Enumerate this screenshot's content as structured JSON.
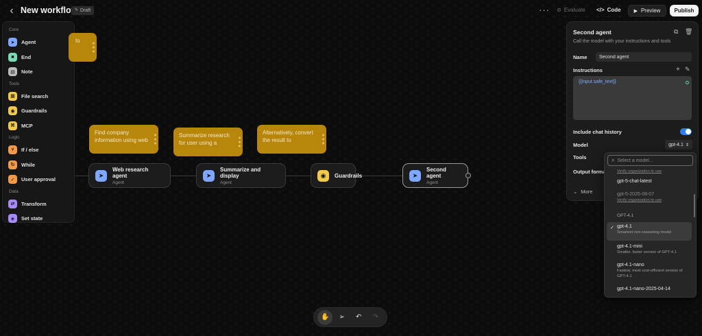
{
  "header": {
    "back_icon": "chevron-left-icon",
    "title": "New workflow",
    "draft_label": "Draft",
    "more_label": "···",
    "evaluate_label": "Evaluate",
    "code_label": "Code",
    "preview_label": "Preview",
    "publish_label": "Publish"
  },
  "palette": {
    "sections": [
      {
        "label": "Core",
        "items": [
          {
            "label": "Agent",
            "icon": "agent-icon",
            "color": "#7ea8ff"
          },
          {
            "label": "End",
            "icon": "end-icon",
            "color": "#79d9b4"
          },
          {
            "label": "Note",
            "icon": "note-icon",
            "color": "#bdbdbd"
          }
        ]
      },
      {
        "label": "Tools",
        "items": [
          {
            "label": "File search",
            "icon": "file-search-icon",
            "color": "#f2c94c"
          },
          {
            "label": "Guardrails",
            "icon": "guardrails-icon",
            "color": "#f2c94c"
          },
          {
            "label": "MCP",
            "icon": "mcp-icon",
            "color": "#f2c94c"
          }
        ]
      },
      {
        "label": "Logic",
        "items": [
          {
            "label": "If / else",
            "icon": "if-else-icon",
            "color": "#f2994a"
          },
          {
            "label": "While",
            "icon": "while-icon",
            "color": "#f2994a"
          },
          {
            "label": "User approval",
            "icon": "user-approval-icon",
            "color": "#f2994a"
          }
        ]
      },
      {
        "label": "Data",
        "items": [
          {
            "label": "Transform",
            "icon": "transform-icon",
            "color": "#a78bfa"
          },
          {
            "label": "Set state",
            "icon": "set-state-icon",
            "color": "#a78bfa"
          }
        ]
      }
    ]
  },
  "canvas": {
    "notes": [
      {
        "text": "to"
      },
      {
        "text": "Find company information using web"
      },
      {
        "text": "Summarize research for user using a"
      },
      {
        "text": "Alternatively, convert the result to"
      }
    ],
    "nodes": [
      {
        "title": "Web research agent",
        "subtitle": "Agent"
      },
      {
        "title": "Summarize and display",
        "subtitle": "Agent"
      },
      {
        "title": "Guardrails",
        "subtitle": ""
      },
      {
        "title": "Second agent",
        "subtitle": "Agent"
      }
    ]
  },
  "panel": {
    "title": "Second agent",
    "description": "Call the model with your instructions and tools",
    "name_label": "Name",
    "name_value": "Second agent",
    "instructions_label": "Instructions",
    "instructions_value": "{{input.safe_text}}",
    "chat_history_label": "Include chat history",
    "chat_history_on": true,
    "model_label": "Model",
    "model_value": "gpt-4.1",
    "tools_label": "Tools",
    "output_format_label": "Output forma",
    "more_label": "More"
  },
  "model_dropdown": {
    "search_placeholder": "Select a model...",
    "top_partial_link": "Verify organization to use",
    "options_a": [
      {
        "title": "gpt-5-chat-latest",
        "subtitle": ""
      },
      {
        "title": "gpt-5-2025-08-07",
        "subtitle": "Verify organization to use"
      }
    ],
    "group_label": "GPT-4.1",
    "options_b": [
      {
        "title": "gpt-4.1",
        "subtitle": "Smartest non-reasoning model",
        "selected": true
      },
      {
        "title": "gpt-4.1-mini",
        "subtitle": "Smaller, faster version of GPT-4.1"
      },
      {
        "title": "gpt-4.1-nano",
        "subtitle": "Fastest, most cost-efficient version of GPT-4.1"
      },
      {
        "title": "gpt-4.1-nano-2025-04-14",
        "subtitle": ""
      }
    ]
  },
  "toolbar": {
    "items": [
      "hand-icon",
      "pointer-icon",
      "undo-icon",
      "redo-icon"
    ]
  }
}
